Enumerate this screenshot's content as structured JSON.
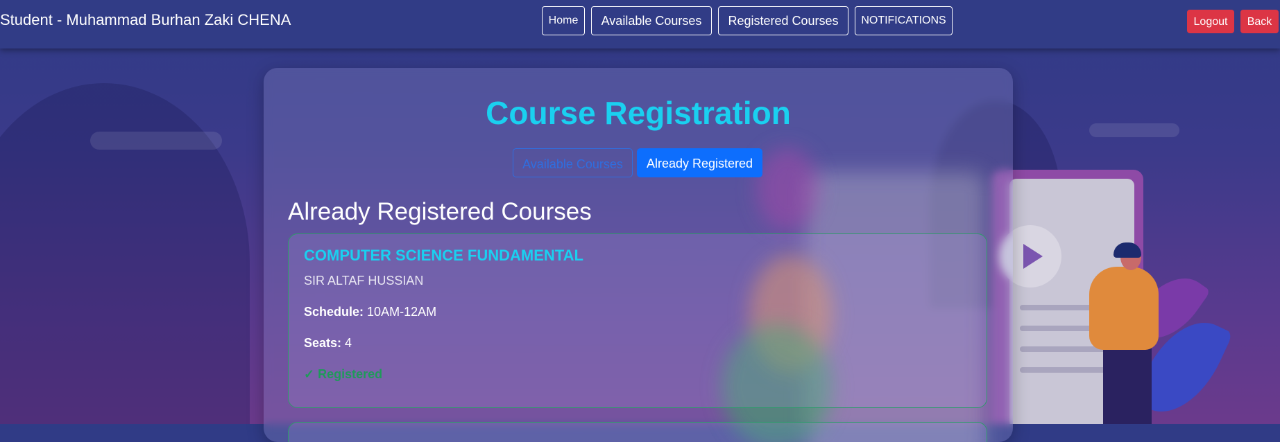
{
  "navbar": {
    "brand": "Student - Muhammad Burhan Zaki CHENA",
    "home": "Home",
    "available_courses": "Available Courses",
    "registered_courses": "Registered Courses",
    "notifications": "NOTIFICATIONS",
    "logout": "Logout",
    "back": "Back"
  },
  "main": {
    "title": "Course Registration",
    "tabs": [
      "Available Courses",
      "Already Registered"
    ],
    "active_tab": "Already Registered",
    "section_heading": "Already Registered Courses",
    "courses": [
      {
        "name": "COMPUTER SCIENCE FUNDAMENTAL",
        "teacher": "SIR ALTAF HUSSIAN",
        "schedule_label": "Schedule:",
        "schedule": "10AM-12AM",
        "seats_label": "Seats:",
        "seats": "4",
        "status_icon": "checkmark-icon",
        "status_icon_glyph": "✓",
        "status": "Registered"
      }
    ]
  },
  "colors": {
    "title_cyan": "#1ad0f0",
    "primary_blue": "#0d6efd",
    "danger_red": "#dc3545",
    "success_green": "#1f9a5a",
    "navbar_bg": "#313c86"
  }
}
